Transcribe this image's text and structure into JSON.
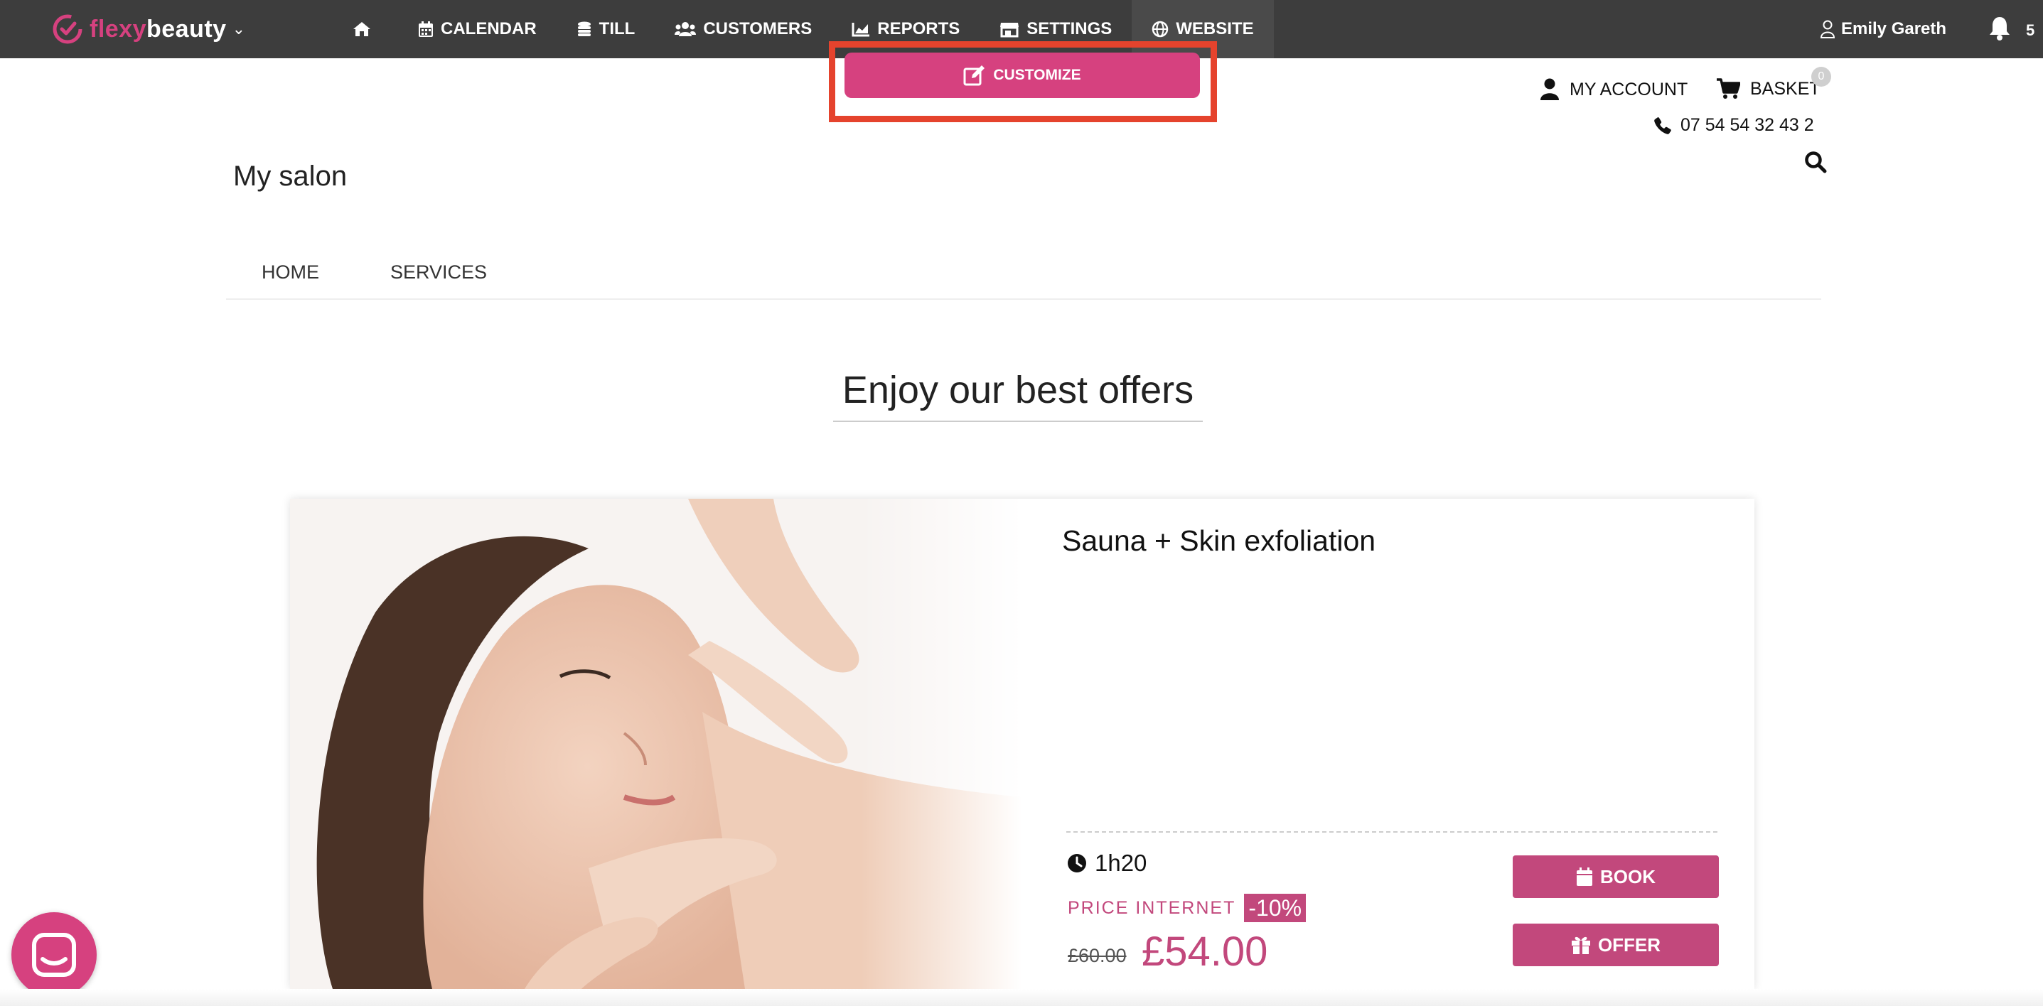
{
  "topbar": {
    "logo": {
      "part1": "flexy",
      "part2": "beauty"
    },
    "nav": [
      {
        "label": "",
        "icon": "home-icon"
      },
      {
        "label": "CALENDAR",
        "icon": "calendar-icon"
      },
      {
        "label": "TILL",
        "icon": "coins-icon"
      },
      {
        "label": "CUSTOMERS",
        "icon": "users-icon"
      },
      {
        "label": "REPORTS",
        "icon": "chart-icon"
      },
      {
        "label": "SETTINGS",
        "icon": "store-icon"
      },
      {
        "label": "WEBSITE",
        "icon": "globe-icon"
      }
    ],
    "user_name": "Emily Gareth",
    "notification_count": "5"
  },
  "customize": {
    "label": "CUSTOMIZE",
    "icon": "edit-icon"
  },
  "header": {
    "my_account": "MY ACCOUNT",
    "basket": "BASKET",
    "basket_count": "0",
    "phone": "07 54 54 32 43 2",
    "salon_name": "My salon"
  },
  "menu": {
    "items": [
      "HOME",
      "SERVICES"
    ]
  },
  "offers": {
    "title": "Enjoy our best offers",
    "card": {
      "title": "Sauna + Skin exfoliation",
      "duration": "1h20",
      "price_label": "PRICE INTERNET",
      "discount": "-10%",
      "old_price": "£60.00",
      "new_price": "£54.00",
      "book_label": "BOOK",
      "offer_label": "OFFER"
    }
  },
  "colors": {
    "topbar": "#3d3d3d",
    "brand_pink": "#d6417f",
    "button_pink": "#c2487c",
    "highlight_red": "#e5432d"
  }
}
